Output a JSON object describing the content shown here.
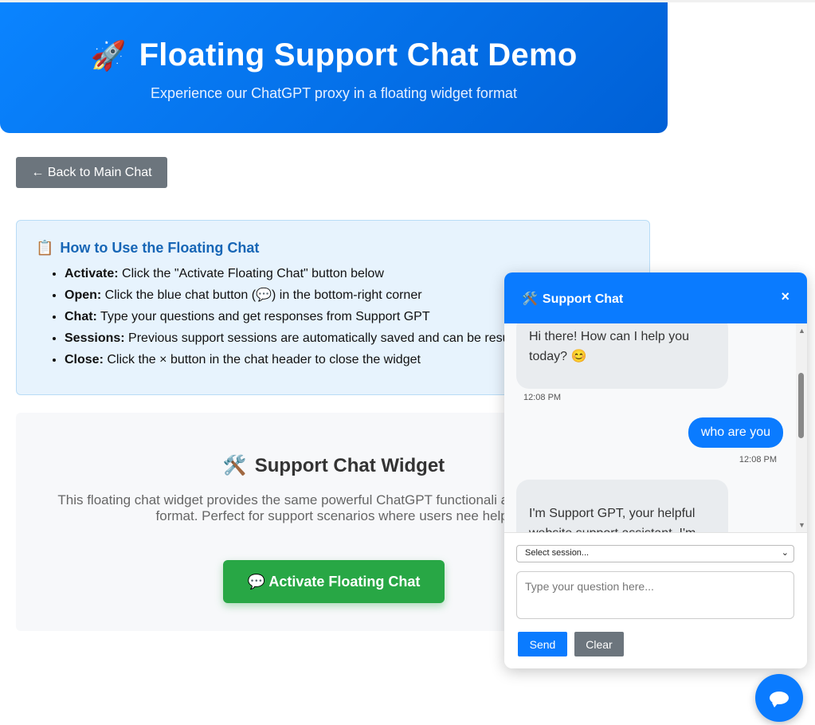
{
  "hero": {
    "emoji": "🚀",
    "title": "Floating Support Chat Demo",
    "subtitle": "Experience our ChatGPT proxy in a floating widget format"
  },
  "back_button": {
    "label": "← Back to Main Chat"
  },
  "howto": {
    "emoji": "📋",
    "title": "How to Use the Floating Chat",
    "items": [
      {
        "label": "Activate:",
        "text": " Click the \"Activate Floating Chat\" button below"
      },
      {
        "label": "Open:",
        "text": " Click the blue chat button (💬) in the bottom-right corner"
      },
      {
        "label": "Chat:",
        "text": " Type your questions and get responses from Support GPT"
      },
      {
        "label": "Sessions:",
        "text": " Previous support sessions are automatically saved and can be resu"
      },
      {
        "label": "Close:",
        "text": " Click the × button in the chat header to close the widget"
      }
    ]
  },
  "widget_section": {
    "emoji": "🛠️",
    "title": "Support Chat Widget",
    "description": "This floating chat widget provides the same powerful ChatGPT functionali always-accessible format. Perfect for support scenarios where users nee help.",
    "activate_label": "💬 Activate Floating Chat"
  },
  "chat": {
    "header_emoji": "🛠️",
    "header_title": "Support Chat",
    "close_label": "×",
    "messages": [
      {
        "role": "bot",
        "text": "Hi there! How can I help you today? 😊",
        "time": "12:08 PM"
      },
      {
        "role": "user",
        "text": "who are you",
        "time": "12:08 PM"
      },
      {
        "role": "bot",
        "text": "I'm Support GPT, your helpful website support assistant. I'm"
      }
    ],
    "session_select": "Select session...",
    "input_placeholder": "Type your question here...",
    "send_label": "Send",
    "clear_label": "Clear"
  },
  "colors": {
    "primary": "#0a7bff",
    "success": "#28a745",
    "secondary": "#6c757d",
    "info_bg": "#e7f3fd",
    "info_title": "#1766b6"
  },
  "icons": [
    "rocket-icon",
    "clipboard-icon",
    "tools-icon",
    "speech-bubble-icon",
    "close-icon",
    "chevron-down-icon",
    "chat-fab-icon"
  ]
}
